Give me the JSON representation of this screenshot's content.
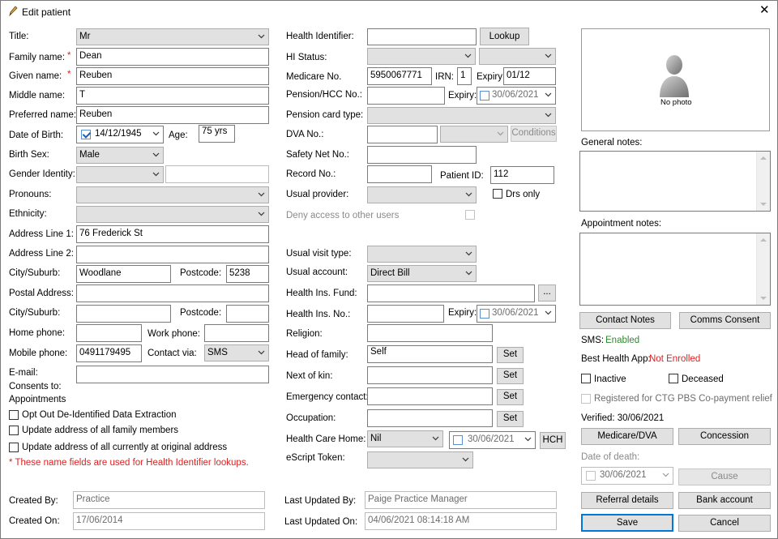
{
  "window": {
    "title": "Edit patient",
    "close_glyph": "✕"
  },
  "left": {
    "title_label": "Title:",
    "title_value": "Mr",
    "family_label": "Family name:",
    "family_value": "Dean",
    "given_label": "Given name:",
    "given_value": "Reuben",
    "required_mark": "*",
    "middle_label": "Middle name:",
    "middle_value": "T",
    "preferred_label": "Preferred name:",
    "preferred_value": "Reuben",
    "dob_label": "Date of Birth:",
    "dob_value": "14/12/1945",
    "age_label": "Age:",
    "age_value": "75 yrs",
    "birth_sex_label": "Birth Sex:",
    "birth_sex_value": "Male",
    "gender_label": "Gender Identity:",
    "pronouns_label": "Pronouns:",
    "ethnicity_label": "Ethnicity:",
    "addr1_label": "Address Line 1:",
    "addr1_value": "76 Frederick St",
    "addr2_label": "Address Line 2:",
    "city_label": "City/Suburb:",
    "city_value": "Woodlane",
    "postcode_label": "Postcode:",
    "postcode_value": "5238",
    "postal_label": "Postal Address:",
    "city2_label": "City/Suburb:",
    "postcode2_label": "Postcode:",
    "home_phone_label": "Home phone:",
    "work_phone_label": "Work phone:",
    "mobile_label": "Mobile phone:",
    "mobile_value": "0491179495",
    "contact_via_label": "Contact via:",
    "contact_via_value": "SMS",
    "email_label": "E-mail:",
    "consents_label": "Consents to:",
    "appointments_label": "Appointments",
    "opt_out_label": "Opt Out De-Identified Data Extraction",
    "update_family_label": "Update address of all family members",
    "update_all_label": "Update address of all currently at original address",
    "note": "* These name fields are used for Health Identifier lookups."
  },
  "middle": {
    "hi_label": "Health Identifier:",
    "lookup_btn": "Lookup",
    "hi_status_label": "HI Status:",
    "medicare_label": "Medicare No.",
    "medicare_value": "5950067771",
    "irn_label": "IRN:",
    "irn_value": "1",
    "expiry_label": "Expiry:",
    "medicare_expiry": "01/12",
    "pension_label": "Pension/HCC No.:",
    "pension_expiry_label": "Expiry:",
    "pension_expiry": "30/06/2021",
    "pension_type_label": "Pension card type:",
    "dva_label": "DVA No.:",
    "conditions_btn": "Conditions",
    "safety_label": "Safety Net No.:",
    "record_label": "Record No.:",
    "patient_id_label": "Patient ID:",
    "patient_id_value": "112",
    "usual_provider_label": "Usual provider:",
    "drs_only_label": "Drs only",
    "deny_label": "Deny access to other users",
    "visit_type_label": "Usual visit type:",
    "account_label": "Usual account:",
    "account_value": "Direct Bill",
    "fund_label": "Health Ins. Fund:",
    "fund_btn": "...",
    "ins_no_label": "Health Ins. No.:",
    "ins_expiry_label": "Expiry:",
    "ins_expiry": "30/06/2021",
    "religion_label": "Religion:",
    "head_label": "Head of family:",
    "head_value": "Self",
    "set_btn": "Set",
    "kin_label": "Next of kin:",
    "emergency_label": "Emergency contact:",
    "occupation_label": "Occupation:",
    "hch_label": "Health Care Home:",
    "hch_value": "Nil",
    "hch_date": "30/06/2021",
    "hch_btn": "HCH",
    "escript_label": "eScript Token:"
  },
  "right": {
    "no_photo": "No photo",
    "general_notes_label": "General notes:",
    "appt_notes_label": "Appointment notes:",
    "contact_notes_btn": "Contact Notes",
    "comms_consent_btn": "Comms Consent",
    "sms_label": "SMS:",
    "sms_value": "Enabled",
    "bha_label": "Best Health App:",
    "bha_value": "Not Enrolled",
    "inactive_label": "Inactive",
    "deceased_label": "Deceased",
    "ctg_label": "Registered for CTG PBS Co-payment relief",
    "verified_label": "Verified: 30/06/2021",
    "medicare_dva_btn": "Medicare/DVA",
    "concession_btn": "Concession",
    "dod_label": "Date of death:",
    "dod_value": "30/06/2021",
    "cause_btn": "Cause",
    "referral_btn": "Referral details",
    "bank_btn": "Bank account",
    "save_btn": "Save",
    "cancel_btn": "Cancel",
    "sms_color": "#2e8b2e",
    "bha_color": "#e02020"
  },
  "footer": {
    "created_by_label": "Created By:",
    "created_by_value": "Practice",
    "created_on_label": "Created On:",
    "created_on_value": "17/06/2014",
    "updated_by_label": "Last Updated By:",
    "updated_by_value": "Paige Practice Manager",
    "updated_on_label": "Last Updated On:",
    "updated_on_value": "04/06/2021 08:14:18 AM"
  }
}
